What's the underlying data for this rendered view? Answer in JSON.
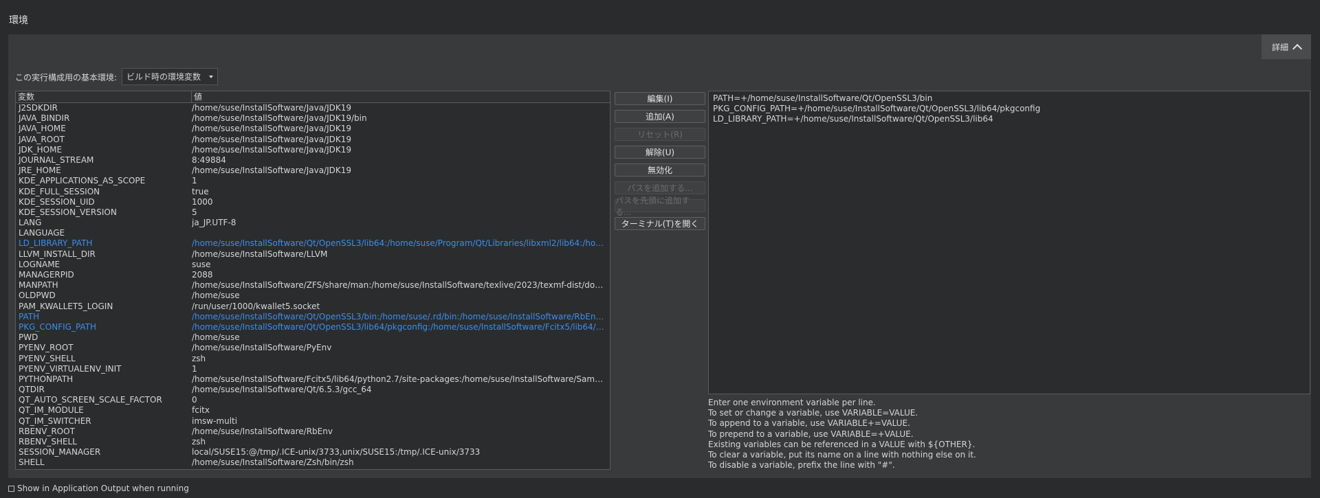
{
  "section_title": "環境",
  "details_button": "詳細",
  "base_env_label": "この実行構成用の基本環境:",
  "base_env_value": "ビルド時の環境変数",
  "table": {
    "headers": [
      "変数",
      "値"
    ],
    "rows": [
      {
        "name": "J2SDKDIR",
        "value": "/home/suse/InstallSoftware/Java/JDK19"
      },
      {
        "name": "JAVA_BINDIR",
        "value": "/home/suse/InstallSoftware/Java/JDK19/bin"
      },
      {
        "name": "JAVA_HOME",
        "value": "/home/suse/InstallSoftware/Java/JDK19"
      },
      {
        "name": "JAVA_ROOT",
        "value": "/home/suse/InstallSoftware/Java/JDK19"
      },
      {
        "name": "JDK_HOME",
        "value": "/home/suse/InstallSoftware/Java/JDK19"
      },
      {
        "name": "JOURNAL_STREAM",
        "value": "8:49884"
      },
      {
        "name": "JRE_HOME",
        "value": "/home/suse/InstallSoftware/Java/JDK19"
      },
      {
        "name": "KDE_APPLICATIONS_AS_SCOPE",
        "value": "1"
      },
      {
        "name": "KDE_FULL_SESSION",
        "value": "true"
      },
      {
        "name": "KDE_SESSION_UID",
        "value": "1000"
      },
      {
        "name": "KDE_SESSION_VERSION",
        "value": "5"
      },
      {
        "name": "LANG",
        "value": "ja_JP.UTF-8"
      },
      {
        "name": "LANGUAGE",
        "value": ""
      },
      {
        "name": "LD_LIBRARY_PATH",
        "value": "/home/suse/InstallSoftware/Qt/OpenSSL3/lib64:/home/suse/Program/Qt/Libraries/libxml2/lib64:/home/s...",
        "modified": true
      },
      {
        "name": "LLVM_INSTALL_DIR",
        "value": "/home/suse/InstallSoftware/LLVM"
      },
      {
        "name": "LOGNAME",
        "value": "suse"
      },
      {
        "name": "MANAGERPID",
        "value": "2088"
      },
      {
        "name": "MANPATH",
        "value": "/home/suse/InstallSoftware/ZFS/share/man:/home/suse/InstallSoftware/texlive/2023/texmf-dist/doc/man..."
      },
      {
        "name": "OLDPWD",
        "value": "/home/suse"
      },
      {
        "name": "PAM_KWALLET5_LOGIN",
        "value": "/run/user/1000/kwallet5.socket"
      },
      {
        "name": "PATH",
        "value": "/home/suse/InstallSoftware/Qt/OpenSSL3/bin:/home/suse/.rd/bin:/home/suse/InstallSoftware/RbEnv/shi...",
        "modified": true
      },
      {
        "name": "PKG_CONFIG_PATH",
        "value": "/home/suse/InstallSoftware/Qt/OpenSSL3/lib64/pkgconfig:/home/suse/InstallSoftware/Fcitx5/lib64/pkgco...",
        "modified": true
      },
      {
        "name": "PWD",
        "value": "/home/suse"
      },
      {
        "name": "PYENV_ROOT",
        "value": "/home/suse/InstallSoftware/PyEnv"
      },
      {
        "name": "PYENV_SHELL",
        "value": "zsh"
      },
      {
        "name": "PYENV_VIRTUALENV_INIT",
        "value": "1"
      },
      {
        "name": "PYTHONPATH",
        "value": "/home/suse/InstallSoftware/Fcitx5/lib64/python2.7/site-packages:/home/suse/InstallSoftware/Samba/lib6..."
      },
      {
        "name": "QTDIR",
        "value": "/home/suse/InstallSoftware/Qt/6.5.3/gcc_64"
      },
      {
        "name": "QT_AUTO_SCREEN_SCALE_FACTOR",
        "value": "0"
      },
      {
        "name": "QT_IM_MODULE",
        "value": "fcitx"
      },
      {
        "name": "QT_IM_SWITCHER",
        "value": "imsw-multi"
      },
      {
        "name": "RBENV_ROOT",
        "value": "/home/suse/InstallSoftware/RbEnv"
      },
      {
        "name": "RBENV_SHELL",
        "value": "zsh"
      },
      {
        "name": "SESSION_MANAGER",
        "value": "local/SUSE15:@/tmp/.ICE-unix/3733,unix/SUSE15:/tmp/.ICE-unix/3733"
      },
      {
        "name": "SHELL",
        "value": "/home/suse/InstallSoftware/Zsh/bin/zsh"
      }
    ]
  },
  "buttons": [
    {
      "label": "編集(I)",
      "enabled": true
    },
    {
      "label": "追加(A)",
      "enabled": true
    },
    {
      "label": "リセット(R)",
      "enabled": false
    },
    {
      "label": "解除(U)",
      "enabled": true
    },
    {
      "label": "無効化",
      "enabled": true
    },
    {
      "label": "パスを追加する...",
      "enabled": false
    },
    {
      "label": "パスを先頭に追加する...",
      "enabled": false
    },
    {
      "label": "ターミナル(T)を開く",
      "enabled": true
    }
  ],
  "editor_lines": [
    "PATH=+/home/suse/InstallSoftware/Qt/OpenSSL3/bin",
    "PKG_CONFIG_PATH=+/home/suse/InstallSoftware/Qt/OpenSSL3/lib64/pkgconfig",
    "LD_LIBRARY_PATH=+/home/suse/InstallSoftware/Qt/OpenSSL3/lib64"
  ],
  "help_lines": [
    "Enter one environment variable per line.",
    "To set or change a variable, use VARIABLE=VALUE.",
    "To append to a variable, use VARIABLE+=VALUE.",
    "To prepend to a variable, use VARIABLE=+VALUE.",
    "Existing variables can be referenced in a VALUE with ${OTHER}.",
    "To clear a variable, put its name on a line with nothing else on it.",
    "To disable a variable, prefix the line with \"#\"."
  ],
  "footer_checkbox_label": "Show in Application Output when running"
}
